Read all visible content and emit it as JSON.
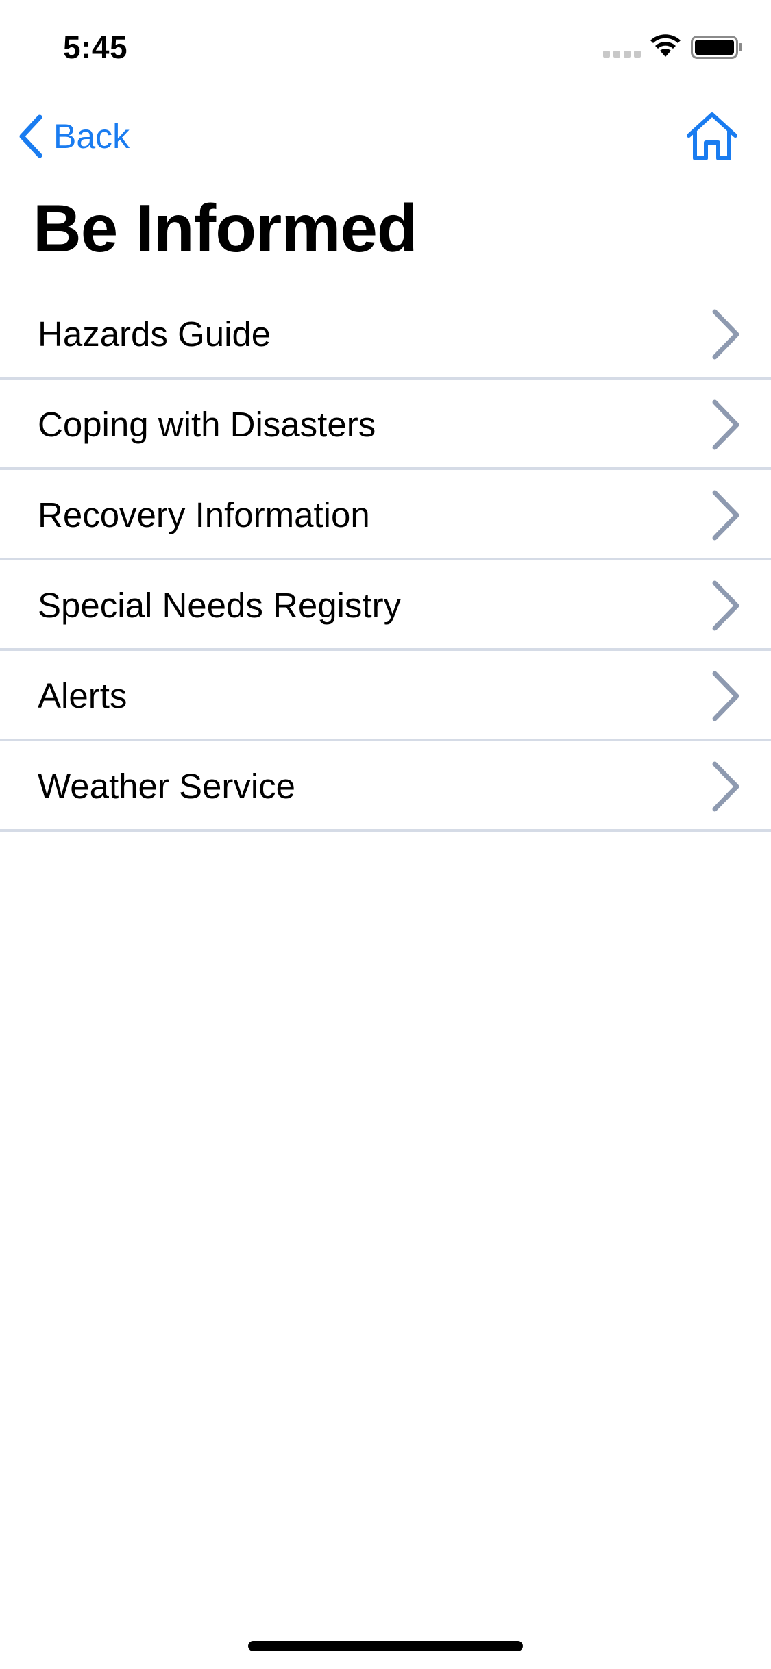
{
  "status_bar": {
    "time": "5:45"
  },
  "nav": {
    "back_label": "Back"
  },
  "page": {
    "title": "Be Informed"
  },
  "menu": {
    "items": [
      {
        "label": "Hazards Guide"
      },
      {
        "label": "Coping with Disasters"
      },
      {
        "label": "Recovery Information"
      },
      {
        "label": "Special Needs Registry"
      },
      {
        "label": "Alerts"
      },
      {
        "label": "Weather Service"
      }
    ]
  },
  "icons": {
    "back": "chevron-left-icon",
    "home": "home-icon",
    "row_disclosure": "chevron-right-icon"
  },
  "colors": {
    "accent": "#1a7cf0",
    "chevron": "#8e9ab0",
    "divider": "#d5dbe6",
    "text": "#000000",
    "background": "#ffffff"
  }
}
